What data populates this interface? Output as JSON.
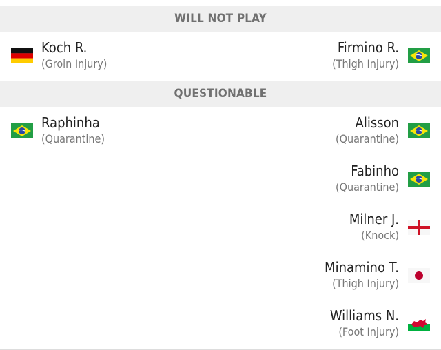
{
  "sections": [
    {
      "title": "WILL NOT PLAY",
      "home": [
        {
          "name": "Koch R.",
          "reason": "(Groin Injury)",
          "flag": "germany-flag"
        }
      ],
      "away": [
        {
          "name": "Firmino R.",
          "reason": "(Thigh Injury)",
          "flag": "brazil-flag"
        }
      ]
    },
    {
      "title": "QUESTIONABLE",
      "home": [
        {
          "name": "Raphinha",
          "reason": "(Quarantine)",
          "flag": "brazil-flag"
        }
      ],
      "away": [
        {
          "name": "Alisson",
          "reason": "(Quarantine)",
          "flag": "brazil-flag"
        },
        {
          "name": "Fabinho",
          "reason": "(Quarantine)",
          "flag": "brazil-flag"
        },
        {
          "name": "Milner J.",
          "reason": "(Knock)",
          "flag": "england-flag"
        },
        {
          "name": "Minamino T.",
          "reason": "(Thigh Injury)",
          "flag": "japan-flag"
        },
        {
          "name": "Williams N.",
          "reason": "(Foot Injury)",
          "flag": "wales-flag"
        }
      ]
    }
  ]
}
